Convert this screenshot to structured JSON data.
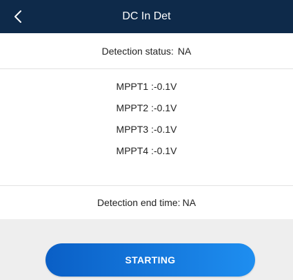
{
  "header": {
    "title": "DC In Det",
    "back_icon": "chevron-left-icon"
  },
  "status": {
    "label": "Detection status:",
    "value": "NA"
  },
  "mppt": [
    {
      "label": "MPPT1 :",
      "value": "-0.1V"
    },
    {
      "label": "MPPT2 :",
      "value": "-0.1V"
    },
    {
      "label": "MPPT3 :",
      "value": "-0.1V"
    },
    {
      "label": "MPPT4 :",
      "value": "-0.1V"
    }
  ],
  "end_time": {
    "label": "Detection end time:",
    "value": "NA"
  },
  "footer": {
    "start_label": "STARTING"
  },
  "colors": {
    "header_bg": "#0e2a4a",
    "button_start": "#0a5fc6",
    "button_end": "#1e8ef0",
    "footer_bg": "#eeeeee"
  }
}
